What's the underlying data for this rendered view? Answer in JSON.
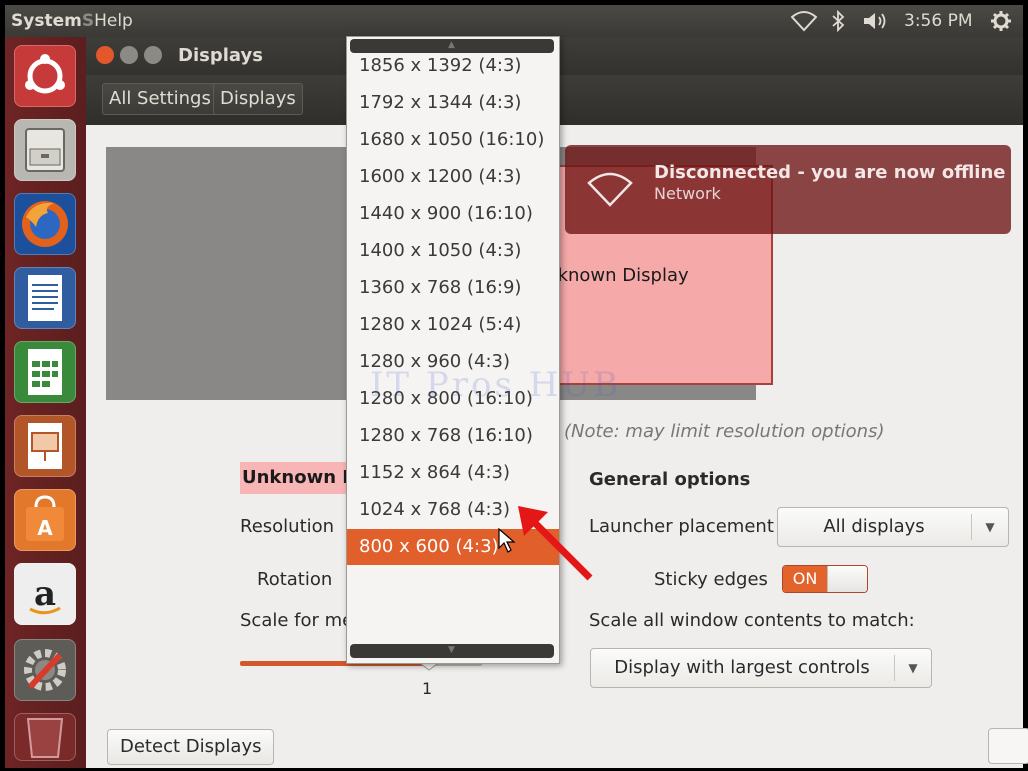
{
  "topbar": {
    "menu_system": "System",
    "menu_hidden_fragment": "S",
    "menu_help": "Help",
    "clock": "3:56 PM"
  },
  "launcher": {
    "icons": [
      "ubuntu-dash-icon",
      "file-manager-icon",
      "firefox-icon",
      "writer-icon",
      "calc-icon",
      "impress-icon",
      "software-center-icon",
      "amazon-icon",
      "system-settings-icon",
      "trash-icon"
    ]
  },
  "window": {
    "title": "Displays",
    "breadcrumb": [
      "All Settings",
      "Displays"
    ]
  },
  "preview": {
    "monitor_label": "Unknown Display"
  },
  "note": "(Note: may limit resolution options)",
  "monitor_settings": {
    "name": "Unknown Di",
    "resolution_label": "Resolution",
    "rotation_label": "Rotation",
    "scale_label": "Scale for me",
    "scale_value": "1"
  },
  "general": {
    "title": "General options",
    "launcher_label": "Launcher placement",
    "launcher_value": "All displays",
    "sticky_label": "Sticky edges",
    "sticky_state": "ON",
    "scale_all_label": "Scale all window contents to match:",
    "scale_all_value": "Display with largest controls"
  },
  "buttons": {
    "detect": "Detect Displays"
  },
  "notification": {
    "title": "Disconnected - you are now offline",
    "subtitle": "Network"
  },
  "dropdown": {
    "options": [
      "1856 x 1392 (4:3)",
      "1792 x 1344 (4:3)",
      "1680 x 1050 (16:10)",
      "1600 x 1200 (4:3)",
      "1440 x 900 (16:10)",
      "1400 x 1050 (4:3)",
      "1360 x 768 (16:9)",
      "1280 x 1024 (5:4)",
      "1280 x 960 (4:3)",
      "1280 x 800 (16:10)",
      "1280 x 768 (16:10)",
      "1152 x 864 (4:3)",
      "1024 x 768 (4:3)",
      "800 x 600 (4:3)"
    ],
    "selected": "800 x 600 (4:3)"
  },
  "watermark": "IT Pros HUB",
  "colors": {
    "accent": "#e15f2a",
    "launcher": "#6e2424",
    "panel": "#3e3d39"
  }
}
